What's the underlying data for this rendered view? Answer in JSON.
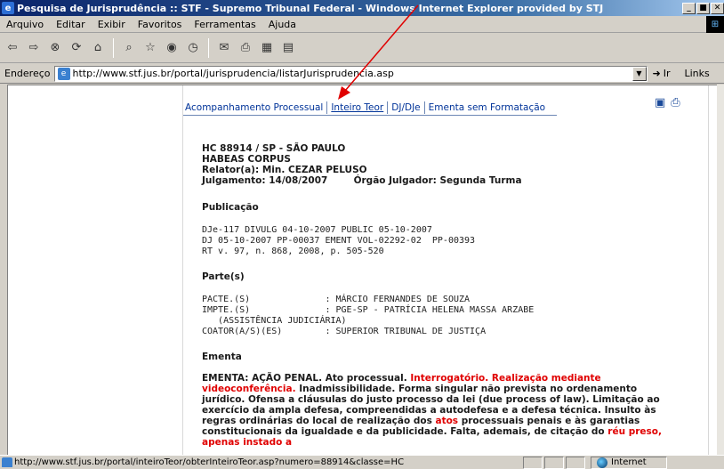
{
  "window": {
    "title": "Pesquisa de Jurisprudência :: STF - Supremo Tribunal Federal - Windows Internet Explorer provided by STJ",
    "controls": [
      "_",
      "■",
      "✕"
    ]
  },
  "menu": [
    "Arquivo",
    "Editar",
    "Exibir",
    "Favoritos",
    "Ferramentas",
    "Ajuda"
  ],
  "address": {
    "label": "Endereço",
    "url": "http://www.stf.jus.br/portal/jurisprudencia/listarJurisprudencia.asp",
    "go_label": "Ir",
    "links_label": "Links"
  },
  "tabs": [
    "Acompanhamento Processual",
    "Inteiro Teor",
    "DJ/DJe",
    "Ementa sem Formatação"
  ],
  "document": {
    "case_line": "HC 88914 / SP - SÃO PAULO",
    "class_line": "HABEAS CORPUS",
    "rapporteur": "Relator(a): Min. CEZAR PELUSO",
    "judgment": "Julgamento: 14/08/2007        Órgão Julgador: Segunda Turma",
    "publication_heading": "Publicação",
    "publication_lines": [
      "DJe-117 DIVULG 04-10-2007 PUBLIC 05-10-2007",
      "DJ 05-10-2007 PP-00037 EMENT VOL-02292-02  PP-00393",
      "RT v. 97, n. 868, 2008, p. 505-520"
    ],
    "parties_heading": "Parte(s)",
    "parties_lines": [
      "PACTE.(S)              : MÁRCIO FERNANDES DE SOUZA",
      "IMPTE.(S)              : PGE-SP - PATRÍCIA HELENA MASSA ARZABE",
      "   (ASSISTÊNCIA JUDICIÁRIA)",
      "COATOR(A/S)(ES)        : SUPERIOR TRIBUNAL DE JUSTIÇA"
    ],
    "ementa_heading": "Ementa",
    "ementa_segments": [
      {
        "t": "EMENTA: AÇÃO PENAL. Ato processual. ",
        "red": false
      },
      {
        "t": "Interrogatório. Realização mediante videoconferência.",
        "red": true
      },
      {
        "t": " Inadmissibilidade. Forma singular não prevista no ordenamento jurídico. Ofensa a cláusulas do justo processo da lei (due process of law). Limitação ao exercício da ampla defesa, compreendidas a autodefesa e a defesa técnica. Insulto às regras ordinárias do local de realização dos ",
        "red": false
      },
      {
        "t": "atos",
        "red": true
      },
      {
        "t": " processuais penais e às garantias constitucionais da igualdade e da publicidade. Falta, ademais, de citação do ",
        "red": false
      },
      {
        "t": "réu preso, apenas instado a",
        "red": true
      }
    ]
  },
  "status": {
    "url": "http://www.stf.jus.br/portal/inteiroTeor/obterInteiroTeor.asp?numero=88914&classe=HC",
    "zone": "Internet"
  },
  "colors": {
    "accent_red": "#e00000",
    "tab_link": "#003399",
    "annotation_arrow": "#e00000"
  }
}
